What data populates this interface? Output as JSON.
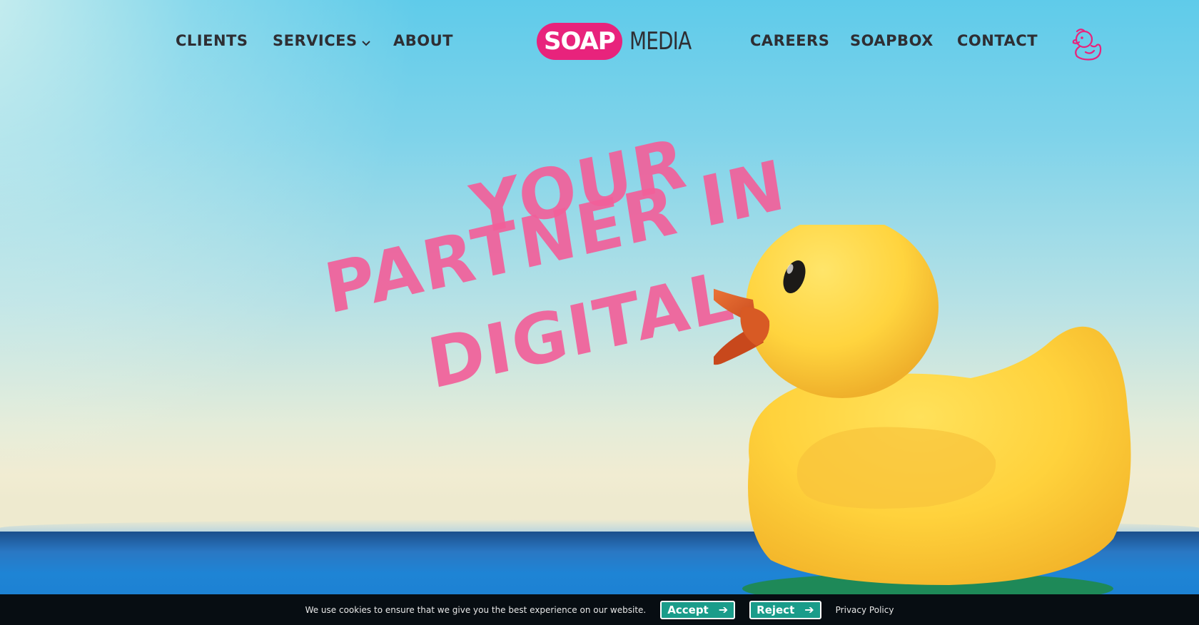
{
  "nav": {
    "left_items": [
      {
        "label": "CLIENTS"
      },
      {
        "label": "SERVICES",
        "has_dropdown": true
      },
      {
        "label": "ABOUT"
      }
    ],
    "right_items": [
      {
        "label": "CAREERS"
      },
      {
        "label": "SOAPBOX"
      },
      {
        "label": "CONTACT"
      }
    ],
    "logo": {
      "pill_text": "SOAP",
      "text": "MEDIA"
    },
    "duck_icon": "rubber-duck-icon"
  },
  "hero": {
    "lines": [
      "YOUR",
      "PARTNER IN",
      "DIGITAL"
    ]
  },
  "cookie_bar": {
    "message": "We use cookies to ensure that we give you the best experience on our website.",
    "accept_label": "Accept",
    "reject_label": "Reject",
    "privacy_label": "Privacy Policy"
  },
  "colors": {
    "brand_pink": "#e8237c",
    "hero_text": "#f2609a",
    "nav_text": "#2e2e33",
    "cookie_button": "#1a9c8a",
    "cookie_bar_bg": "#070d12"
  }
}
